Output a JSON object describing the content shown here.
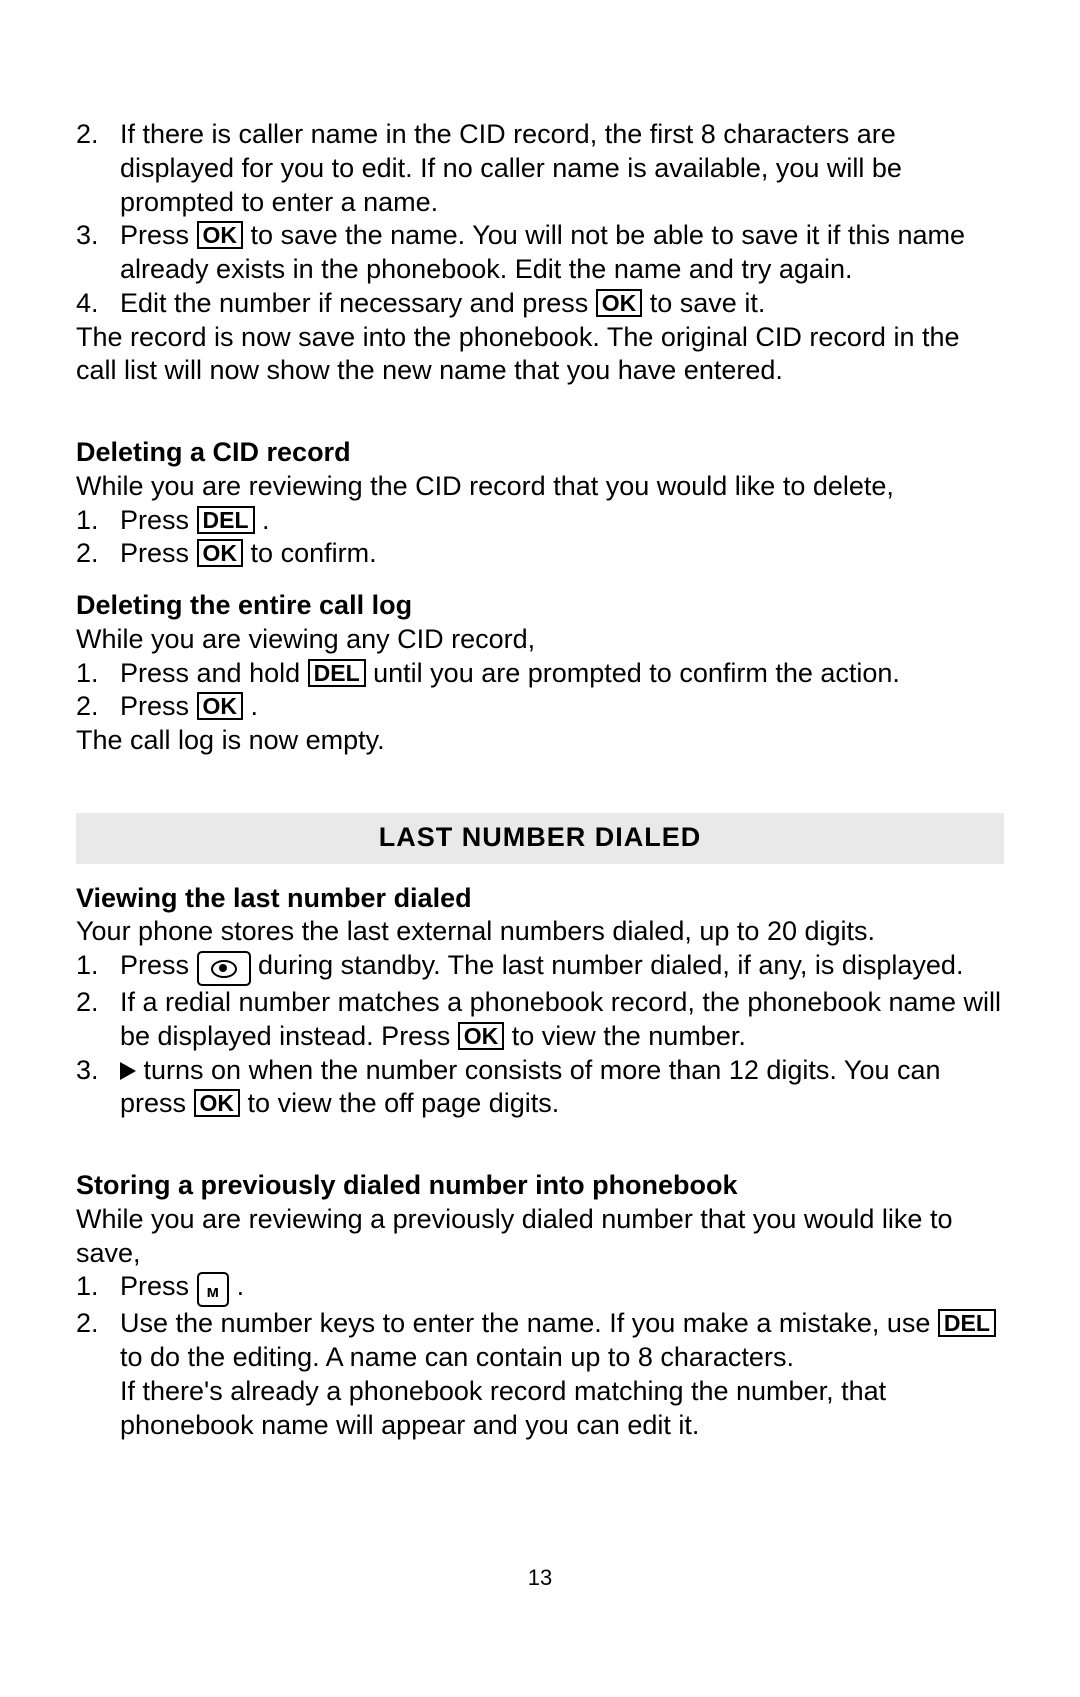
{
  "buttons": {
    "ok": "OK",
    "del": "DEL"
  },
  "top_list": {
    "i2": {
      "marker": "2.",
      "text_a": "If there is caller name in the CID record, the first 8 characters are displayed for you to edit.  If no caller name is available, you will be prompted to enter a name."
    },
    "i3": {
      "marker": "3.",
      "text_a": "Press ",
      "text_b": " to save the name.  You will not be able to save it if this name already exists in the phonebook.  Edit the name and try again."
    },
    "i4": {
      "marker": "4.",
      "text_a": "Edit the number if necessary and press ",
      "text_b": " to save it."
    }
  },
  "top_after": "The record is now save into the phonebook.  The original CID record in the call list will now show the new name that you have entered.",
  "del_cid": {
    "heading": "Deleting a CID record",
    "intro": "While you are reviewing the CID record that you would like to delete,",
    "i1": {
      "marker": "1.",
      "a": "Press ",
      "b": "."
    },
    "i2": {
      "marker": "2.",
      "a": "Press ",
      "b": " to confirm."
    }
  },
  "del_log": {
    "heading": "Deleting the entire call log",
    "intro": "While you are viewing any CID record,",
    "i1": {
      "marker": "1.",
      "a": "Press and hold ",
      "b": " until you are prompted to confirm the action."
    },
    "i2": {
      "marker": "2.",
      "a": "Press ",
      "b": "."
    },
    "outro": "The call log is now empty."
  },
  "section_header": "LAST NUMBER DIALED",
  "view_last": {
    "heading": "Viewing the last number dialed",
    "intro": "Your phone stores the last external numbers dialed, up to 20 digits.",
    "i1": {
      "marker": "1.",
      "a": "Press ",
      "b": " during standby.  The last number dialed, if any, is displayed."
    },
    "i2": {
      "marker": "2.",
      "a": "If a redial number matches a phonebook record, the phonebook name will be displayed instead.  Press ",
      "b": " to view the number."
    },
    "i3": {
      "marker": "3.",
      "a": " turns on when the number consists of more than 12 digits.  You can press ",
      "b": " to view the off page digits."
    }
  },
  "store": {
    "heading": "Storing a previously dialed number into phonebook",
    "intro": "While you are reviewing a previously dialed number that you would like to save,",
    "i1": {
      "marker": "1.",
      "a": "Press ",
      "b": "."
    },
    "i2": {
      "marker": "2.",
      "a": "Use the number keys to enter the name.  If you make a mistake, use ",
      "b": " to do the editing.  A name can contain up to 8 characters.",
      "c": "If there's already a phonebook record matching the number, that phonebook name will appear and you can edit it."
    }
  },
  "page_number": "13"
}
